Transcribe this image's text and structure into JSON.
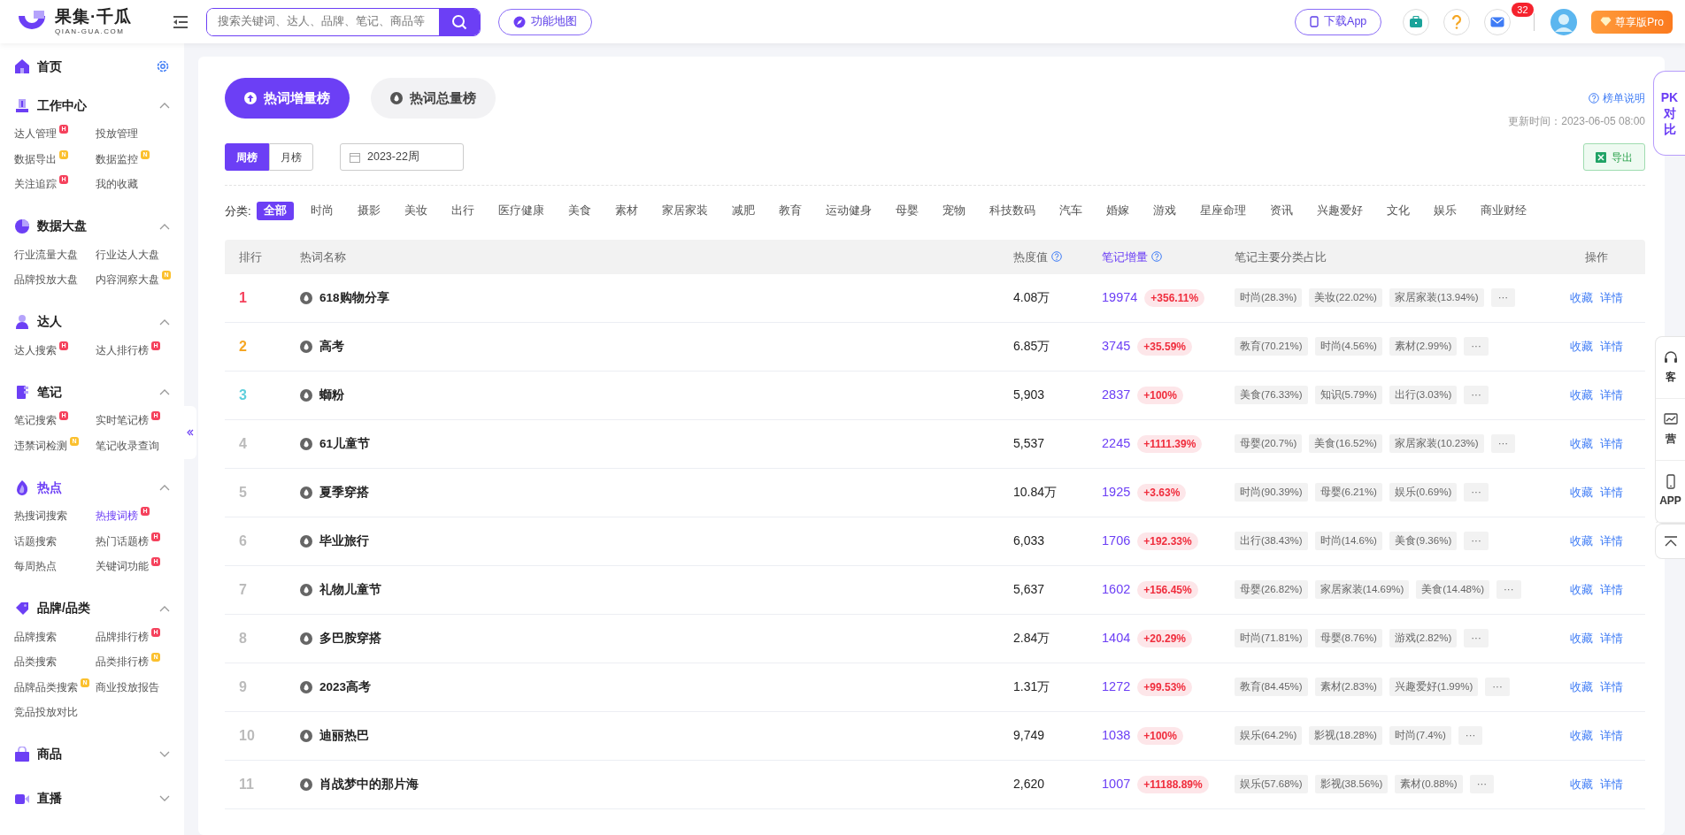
{
  "header": {
    "logo": "果集·千瓜",
    "logo_sub": "QIAN-GUA.COM",
    "search": {
      "placeholder": "搜索关键词、达人、品牌、笔记、商品等"
    },
    "map_button": "功能地图",
    "download_button": "下载App",
    "message_count": "32",
    "pro_button": "尊享版Pro"
  },
  "sidebar": {
    "home": "首页",
    "sections": [
      {
        "title": "工作中心",
        "selected": false,
        "expanded": true,
        "items": [
          {
            "label": "达人管理",
            "selected": false,
            "badge": {
              "text": "H",
              "color": "#f5415c"
            }
          },
          {
            "label": "投放管理",
            "selected": false
          },
          {
            "label": "数据导出",
            "selected": false,
            "badge": {
              "text": "N",
              "color": "#fbc02d"
            }
          },
          {
            "label": "数据监控",
            "selected": false,
            "badge": {
              "text": "N",
              "color": "#fbc02d"
            }
          },
          {
            "label": "关注追踪",
            "selected": false,
            "badge": {
              "text": "H",
              "color": "#f5415c"
            }
          },
          {
            "label": "我的收藏",
            "selected": false
          }
        ]
      },
      {
        "title": "数据大盘",
        "selected": false,
        "expanded": true,
        "items": [
          {
            "label": "行业流量大盘",
            "selected": false
          },
          {
            "label": "行业达人大盘",
            "selected": false
          },
          {
            "label": "品牌投放大盘",
            "selected": false
          },
          {
            "label": "内容洞察大盘",
            "selected": false,
            "badge": {
              "text": "N",
              "color": "#fbc02d"
            }
          }
        ]
      },
      {
        "title": "达人",
        "selected": false,
        "expanded": true,
        "items": [
          {
            "label": "达人搜索",
            "selected": false,
            "badge": {
              "text": "H",
              "color": "#f5415c"
            }
          },
          {
            "label": "达人排行榜",
            "selected": false,
            "badge": {
              "text": "H",
              "color": "#f5415c"
            }
          }
        ]
      },
      {
        "title": "笔记",
        "selected": false,
        "expanded": true,
        "items": [
          {
            "label": "笔记搜索",
            "selected": false,
            "badge": {
              "text": "H",
              "color": "#f5415c"
            }
          },
          {
            "label": "实时笔记榜",
            "selected": false,
            "badge": {
              "text": "H",
              "color": "#f5415c"
            }
          },
          {
            "label": "违禁词检测",
            "selected": false,
            "badge": {
              "text": "N",
              "color": "#fbc02d"
            }
          },
          {
            "label": "笔记收录查询",
            "selected": false
          }
        ]
      },
      {
        "title": "热点",
        "selected": true,
        "expanded": true,
        "items": [
          {
            "label": "热搜词搜索",
            "selected": false
          },
          {
            "label": "热搜词榜",
            "selected": true,
            "badge": {
              "text": "H",
              "color": "#f5415c"
            }
          },
          {
            "label": "话题搜索",
            "selected": false
          },
          {
            "label": "热门话题榜",
            "selected": false,
            "badge": {
              "text": "H",
              "color": "#f5415c"
            }
          },
          {
            "label": "每周热点",
            "selected": false
          },
          {
            "label": "关键词功能",
            "selected": false,
            "badge": {
              "text": "H",
              "color": "#f5415c"
            }
          }
        ]
      },
      {
        "title": "品牌/品类",
        "selected": false,
        "expanded": true,
        "items": [
          {
            "label": "品牌搜索",
            "selected": false
          },
          {
            "label": "品牌排行榜",
            "selected": false,
            "badge": {
              "text": "H",
              "color": "#f5415c"
            }
          },
          {
            "label": "品类搜索",
            "selected": false
          },
          {
            "label": "品类排行榜",
            "selected": false,
            "badge": {
              "text": "N",
              "color": "#fbc02d"
            }
          },
          {
            "label": "品牌品类搜索",
            "selected": false,
            "badge": {
              "text": "N",
              "color": "#fbc02d"
            }
          },
          {
            "label": "商业投放报告",
            "selected": false
          },
          {
            "label": "竞品投放对比",
            "selected": false
          }
        ]
      },
      {
        "title": "商品",
        "selected": false,
        "expanded": false
      },
      {
        "title": "直播",
        "selected": false,
        "expanded": false
      }
    ]
  },
  "main": {
    "tabs": [
      {
        "label": "热词增量榜",
        "selected": true
      },
      {
        "label": "热词总量榜",
        "selected": false
      }
    ],
    "help_link": "榜单说明",
    "updated": "更新时间：2023-06-05 08:00",
    "period_tabs": [
      {
        "label": "周榜",
        "selected": true
      },
      {
        "label": "月榜",
        "selected": false
      }
    ],
    "date_field": {
      "value": "2023-22周"
    },
    "export_button": "导出",
    "category_label": "分类:",
    "categories": [
      {
        "label": "全部",
        "selected": true
      },
      {
        "label": "时尚",
        "selected": false
      },
      {
        "label": "摄影",
        "selected": false
      },
      {
        "label": "美妆",
        "selected": false
      },
      {
        "label": "出行",
        "selected": false
      },
      {
        "label": "医疗健康",
        "selected": false
      },
      {
        "label": "美食",
        "selected": false
      },
      {
        "label": "素材",
        "selected": false
      },
      {
        "label": "家居家装",
        "selected": false
      },
      {
        "label": "减肥",
        "selected": false
      },
      {
        "label": "教育",
        "selected": false
      },
      {
        "label": "运动健身",
        "selected": false
      },
      {
        "label": "母婴",
        "selected": false
      },
      {
        "label": "宠物",
        "selected": false
      },
      {
        "label": "科技数码",
        "selected": false
      },
      {
        "label": "汽车",
        "selected": false
      },
      {
        "label": "婚嫁",
        "selected": false
      },
      {
        "label": "游戏",
        "selected": false
      },
      {
        "label": "星座命理",
        "selected": false
      },
      {
        "label": "资讯",
        "selected": false
      },
      {
        "label": "兴趣爱好",
        "selected": false
      },
      {
        "label": "文化",
        "selected": false
      },
      {
        "label": "娱乐",
        "selected": false
      },
      {
        "label": "商业财经",
        "selected": false
      }
    ],
    "table": {
      "columns": [
        {
          "label": "排行",
          "help": false,
          "selected": false
        },
        {
          "label": "热词名称",
          "help": false,
          "selected": false
        },
        {
          "label": "热度值",
          "help": true,
          "selected": false
        },
        {
          "label": "笔记增量",
          "help": true,
          "selected": true
        },
        {
          "label": "笔记主要分类占比",
          "help": false,
          "selected": false
        },
        {
          "label": "操作",
          "help": false,
          "selected": false
        }
      ],
      "rows": [
        {
          "rank": "1",
          "name": "618购物分享",
          "heat": "4.08万",
          "notes": "19974",
          "growth": "+356.11%",
          "shares": [
            "时尚(28.3%)",
            "美妆(22.02%)",
            "家居家装(13.94%)"
          ],
          "more": "···",
          "actions": [
            "收藏",
            "详情"
          ]
        },
        {
          "rank": "2",
          "name": "高考",
          "heat": "6.85万",
          "notes": "3745",
          "growth": "+35.59%",
          "shares": [
            "教育(70.21%)",
            "时尚(4.56%)",
            "素材(2.99%)"
          ],
          "more": "···",
          "actions": [
            "收藏",
            "详情"
          ]
        },
        {
          "rank": "3",
          "name": "螄粉",
          "heat": "5,903",
          "notes": "2837",
          "growth": "+100%",
          "shares": [
            "美食(76.33%)",
            "知识(5.79%)",
            "出行(3.03%)"
          ],
          "more": "···",
          "actions": [
            "收藏",
            "详情"
          ]
        },
        {
          "rank": "4",
          "name": "61儿童节",
          "heat": "5,537",
          "notes": "2245",
          "growth": "+1111.39%",
          "shares": [
            "母婴(20.7%)",
            "美食(16.52%)",
            "家居家装(10.23%)"
          ],
          "more": "···",
          "actions": [
            "收藏",
            "详情"
          ]
        },
        {
          "rank": "5",
          "name": "夏季穿搭",
          "heat": "10.84万",
          "notes": "1925",
          "growth": "+3.63%",
          "shares": [
            "时尚(90.39%)",
            "母婴(6.21%)",
            "娱乐(0.69%)"
          ],
          "more": "···",
          "actions": [
            "收藏",
            "详情"
          ]
        },
        {
          "rank": "6",
          "name": "毕业旅行",
          "heat": "6,033",
          "notes": "1706",
          "growth": "+192.33%",
          "shares": [
            "出行(38.43%)",
            "时尚(14.6%)",
            "美食(9.36%)"
          ],
          "more": "···",
          "actions": [
            "收藏",
            "详情"
          ]
        },
        {
          "rank": "7",
          "name": "礼物儿童节",
          "heat": "5,637",
          "notes": "1602",
          "growth": "+156.45%",
          "shares": [
            "母婴(26.82%)",
            "家居家装(14.69%)",
            "美食(14.48%)"
          ],
          "more": "···",
          "actions": [
            "收藏",
            "详情"
          ]
        },
        {
          "rank": "8",
          "name": "多巴胺穿搭",
          "heat": "2.84万",
          "notes": "1404",
          "growth": "+20.29%",
          "shares": [
            "时尚(71.81%)",
            "母婴(8.76%)",
            "游戏(2.82%)"
          ],
          "more": "···",
          "actions": [
            "收藏",
            "详情"
          ]
        },
        {
          "rank": "9",
          "name": "2023高考",
          "heat": "1.31万",
          "notes": "1272",
          "growth": "+99.53%",
          "shares": [
            "教育(84.45%)",
            "素材(2.83%)",
            "兴趣爱好(1.99%)"
          ],
          "more": "···",
          "actions": [
            "收藏",
            "详情"
          ]
        },
        {
          "rank": "10",
          "name": "迪丽热巴",
          "heat": "9,749",
          "notes": "1038",
          "growth": "+100%",
          "shares": [
            "娱乐(64.2%)",
            "影视(18.28%)",
            "时尚(7.4%)"
          ],
          "more": "···",
          "actions": [
            "收藏",
            "详情"
          ]
        },
        {
          "rank": "11",
          "name": "肖战梦中的那片海",
          "heat": "2,620",
          "notes": "1007",
          "growth": "+11188.89%",
          "shares": [
            "娱乐(57.68%)",
            "影视(38.56%)",
            "素材(0.88%)"
          ],
          "more": "···",
          "actions": [
            "收藏",
            "详情"
          ]
        }
      ]
    }
  },
  "right_float": {
    "pk_tab": [
      "PK",
      "对比"
    ],
    "tools": [
      "客",
      "营",
      "APP"
    ]
  }
}
